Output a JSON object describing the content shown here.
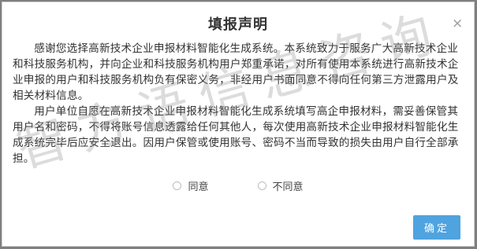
{
  "dialog": {
    "title": "填报声明",
    "close_glyph": "×",
    "paragraphs": [
      "感谢您选择高新技术企业申报材料智能化生成系统。本系统致力于服务广大高新技术企业和科技服务机构，并向企业和科技服务机构用户郑重承诺，对所有使用本系统进行高新技术企业申报的用户和科技服务机构负有保密义务，非经用户书面同意不得向任何第三方泄露用户及相关材料信息。",
      "用户单位自愿在高新技术企业申报材料智能化生成系统填写高企申报材料，需妥善保管其用户名和密码，不得将账号信息透露给任何其他人，每次使用高新技术企业申报材料智能化生成系统完毕后应安全退出。因用户保管或使用账号、密码不当而导致的损失由用户自行全部承担。"
    ],
    "watermark": "智方语信息咨询",
    "options": {
      "agree_label": "同意",
      "disagree_label": "不同意"
    },
    "ok_label": "确定"
  },
  "colors": {
    "overlay": "#7f7f7f",
    "primary_button": "#4fa3df"
  },
  "icons": {
    "close": "close-icon",
    "radio": "radio-circle"
  }
}
